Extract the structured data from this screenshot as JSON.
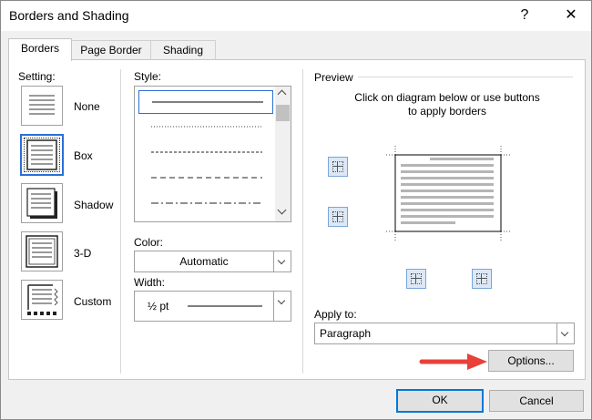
{
  "window": {
    "title": "Borders and Shading",
    "help": "?",
    "close": "✕"
  },
  "tabs": [
    {
      "label": "Borders"
    },
    {
      "label": "Page Border"
    },
    {
      "label": "Shading"
    }
  ],
  "setting": {
    "label": "Setting:",
    "items": [
      {
        "label": "None"
      },
      {
        "label": "Box"
      },
      {
        "label": "Shadow"
      },
      {
        "label": "3-D"
      },
      {
        "label": "Custom"
      }
    ],
    "selected": "Box"
  },
  "style": {
    "label": "Style:"
  },
  "color": {
    "label": "Color:",
    "value": "Automatic"
  },
  "width": {
    "label": "Width:",
    "value": "½ pt"
  },
  "preview": {
    "label": "Preview",
    "instructions_line1": "Click on diagram below or use buttons",
    "instructions_line2": "to apply borders"
  },
  "apply_to": {
    "label": "Apply to:",
    "value": "Paragraph"
  },
  "options_label": "Options...",
  "ok_label": "OK",
  "cancel_label": "Cancel",
  "colors": {
    "accent": "#2a6fd6",
    "arrow": "#e8413a"
  }
}
